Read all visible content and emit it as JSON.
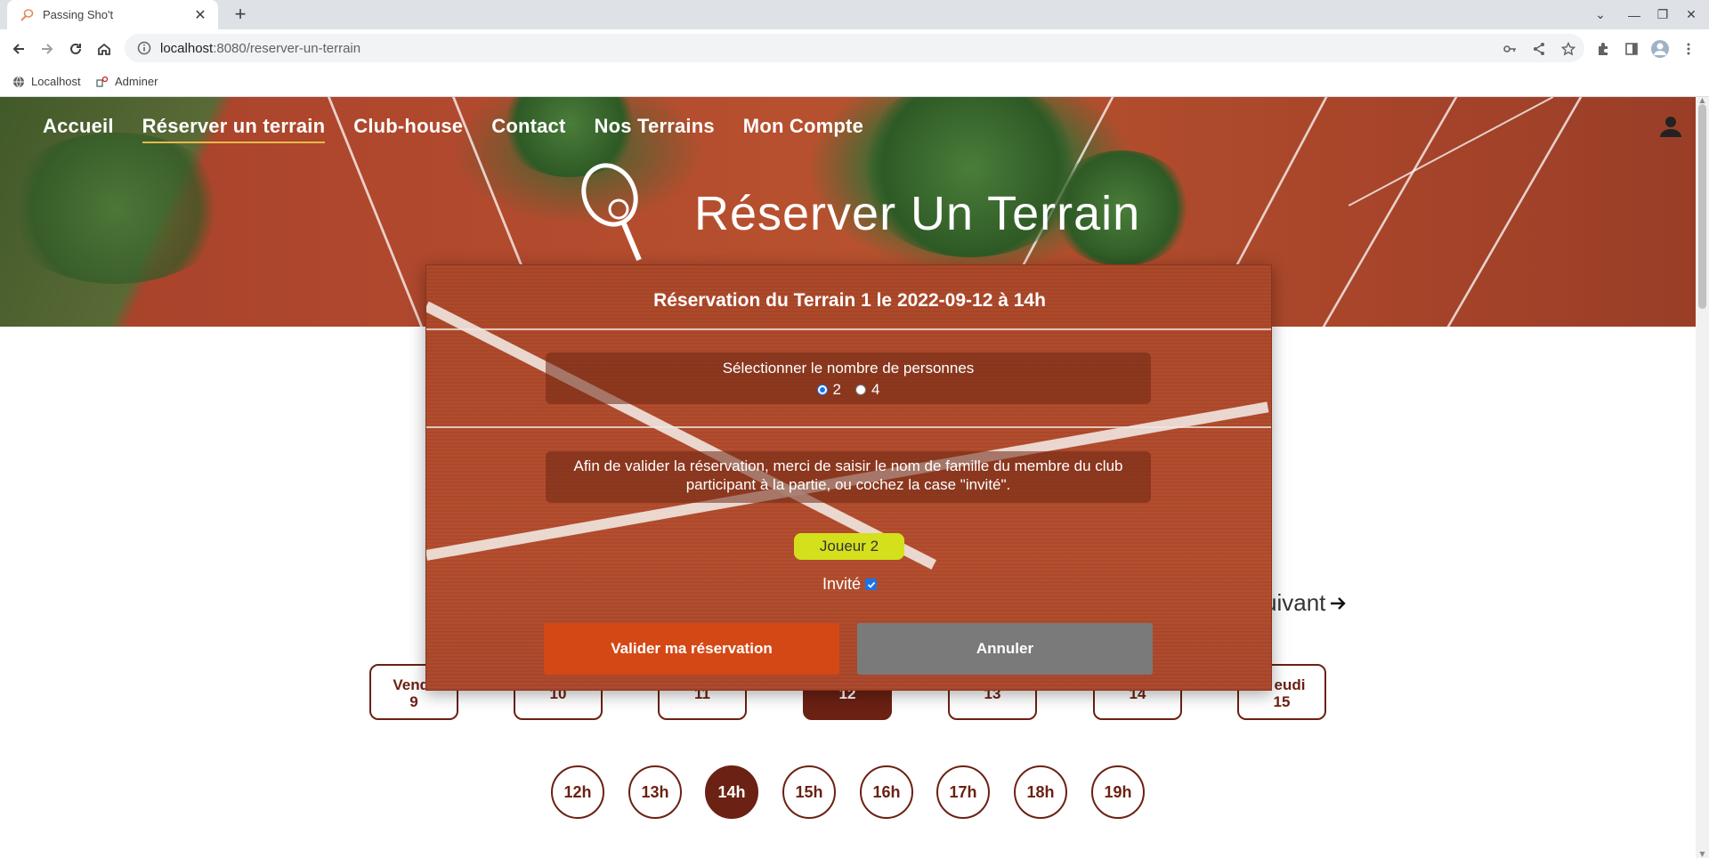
{
  "browser": {
    "tab_title": "Passing Sho't",
    "url_host": "localhost",
    "url_path": ":8080/reserver-un-terrain",
    "bookmarks": [
      "Localhost",
      "Adminer"
    ]
  },
  "nav": {
    "items": [
      "Accueil",
      "Réserver un terrain",
      "Club-house",
      "Contact",
      "Nos Terrains",
      "Mon Compte"
    ],
    "active_index": 1
  },
  "hero": {
    "title": "Réserver Un Terrain"
  },
  "modal": {
    "title": "Réservation du Terrain 1 le 2022-09-12 à 14h",
    "persons_label": "Sélectionner le nombre de personnes",
    "persons_options": [
      "2",
      "4"
    ],
    "persons_selected": "2",
    "info_text": "Afin de valider la réservation, merci de saisir le nom de famille du membre du club participant à la partie, ou cochez la case \"invité\".",
    "player_label": "Joueur 2",
    "guest_label": "Invité",
    "guest_checked": true,
    "confirm_label": "Valider ma réservation",
    "cancel_label": "Annuler"
  },
  "calendar": {
    "next_label": "uivant",
    "days": [
      {
        "name": "Vendr",
        "num": "9"
      },
      {
        "name": "",
        "num": "10"
      },
      {
        "name": "",
        "num": "11"
      },
      {
        "name": "",
        "num": "12"
      },
      {
        "name": "",
        "num": "13"
      },
      {
        "name": "",
        "num": "14"
      },
      {
        "name": "eudi",
        "num": "15"
      }
    ],
    "selected_day": "12",
    "hours": [
      "12h",
      "13h",
      "14h",
      "15h",
      "16h",
      "17h",
      "18h",
      "19h"
    ],
    "selected_hour": "14h"
  },
  "colors": {
    "brand_dark": "#6b2113",
    "confirm": "#d44816",
    "cancel": "#7a7a7a",
    "player_pill": "#d4e01c"
  }
}
